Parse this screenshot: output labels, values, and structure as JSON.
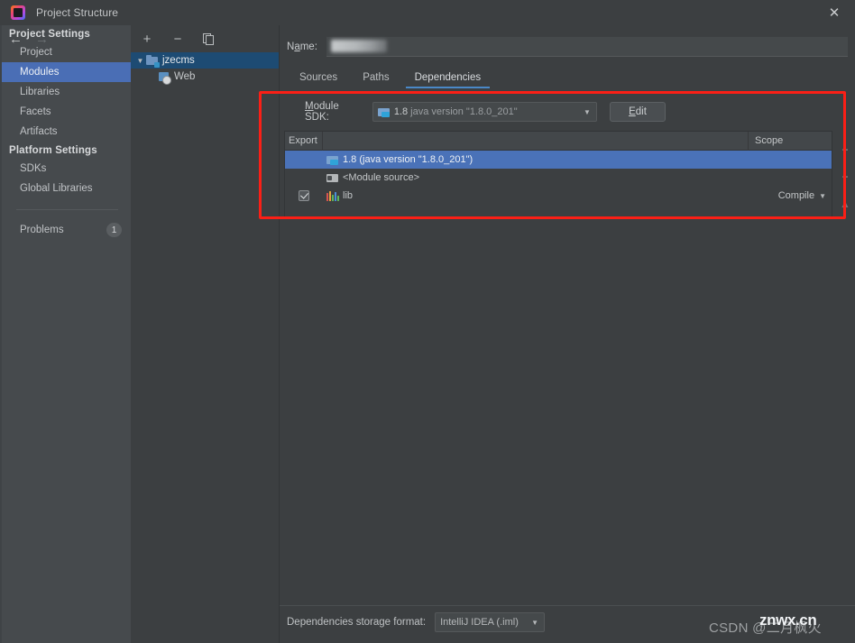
{
  "window": {
    "title": "Project Structure",
    "app_icon": "intellij-idea-icon",
    "close_label": "✕"
  },
  "nav": {
    "back_icon": "←",
    "forward_icon": "→",
    "groups": [
      {
        "title": "Project Settings",
        "items": [
          {
            "label": "Project",
            "selected": false
          },
          {
            "label": "Modules",
            "selected": true
          },
          {
            "label": "Libraries",
            "selected": false
          },
          {
            "label": "Facets",
            "selected": false
          },
          {
            "label": "Artifacts",
            "selected": false
          }
        ]
      },
      {
        "title": "Platform Settings",
        "items": [
          {
            "label": "SDKs",
            "selected": false
          },
          {
            "label": "Global Libraries",
            "selected": false
          }
        ]
      }
    ],
    "problems": {
      "label": "Problems",
      "count": "1"
    }
  },
  "tree": {
    "toolbar": {
      "add_label": "+",
      "remove_label": "−",
      "copy_icon": "copy-icon"
    },
    "nodes": [
      {
        "label": "jzecms",
        "icon": "module-icon",
        "selected": true,
        "twisty": "▼",
        "depth": 0
      },
      {
        "label": "Web",
        "icon": "web-facet-icon",
        "selected": false,
        "twisty": "",
        "depth": 1
      }
    ]
  },
  "main": {
    "name": {
      "label_pre": "N",
      "label_mid": "a",
      "label_post": "me:",
      "label": "Name:",
      "value": "",
      "redacted": true
    },
    "tabs": [
      {
        "label": "Sources",
        "active": false
      },
      {
        "label": "Paths",
        "active": false
      },
      {
        "label": "Dependencies",
        "active": true
      }
    ],
    "sdk": {
      "label": "Module SDK:",
      "value_bold": "1.8",
      "value_rest": " java version \"1.8.0_201\"",
      "caret": "▼",
      "edit_button": "Edit"
    },
    "table": {
      "columns": {
        "export": "Export",
        "middle": "",
        "scope": "Scope"
      },
      "rows": [
        {
          "checked": null,
          "icon": "sdk-folder-icon",
          "name": "1.8 (java version \"1.8.0_201\")",
          "scope": "",
          "scope_caret": "",
          "selected": true
        },
        {
          "checked": null,
          "icon": "module-source-icon",
          "name": "<Module source>",
          "scope": "",
          "scope_caret": "",
          "selected": false
        },
        {
          "checked": true,
          "icon": "library-icon",
          "name": "lib",
          "scope": "Compile",
          "scope_caret": "▼",
          "selected": false
        }
      ],
      "side_buttons": [
        {
          "name": "add-dependency-button",
          "glyph": "+"
        },
        {
          "name": "remove-dependency-button",
          "glyph": "−"
        },
        {
          "name": "move-up-button",
          "glyph": "▲"
        },
        {
          "name": "move-down-button",
          "glyph": "▼"
        }
      ],
      "resize_grip": "⤡"
    },
    "bottom": {
      "label": "Dependencies storage format:",
      "value": "IntelliJ IDEA (.iml)",
      "caret": "▼"
    }
  },
  "watermark": {
    "csdn": "CSDN @二月枫火",
    "site": "znwx.cn"
  },
  "colors": {
    "accent_blue": "#4a6eb5",
    "selection_blue": "#4a72b8",
    "tree_selection": "#1d4b73",
    "tab_underline": "#4a88c7",
    "annotation_red": "#fb1f16",
    "panel_bg": "#3c3f41",
    "sidebar_bg": "#464a4d"
  }
}
